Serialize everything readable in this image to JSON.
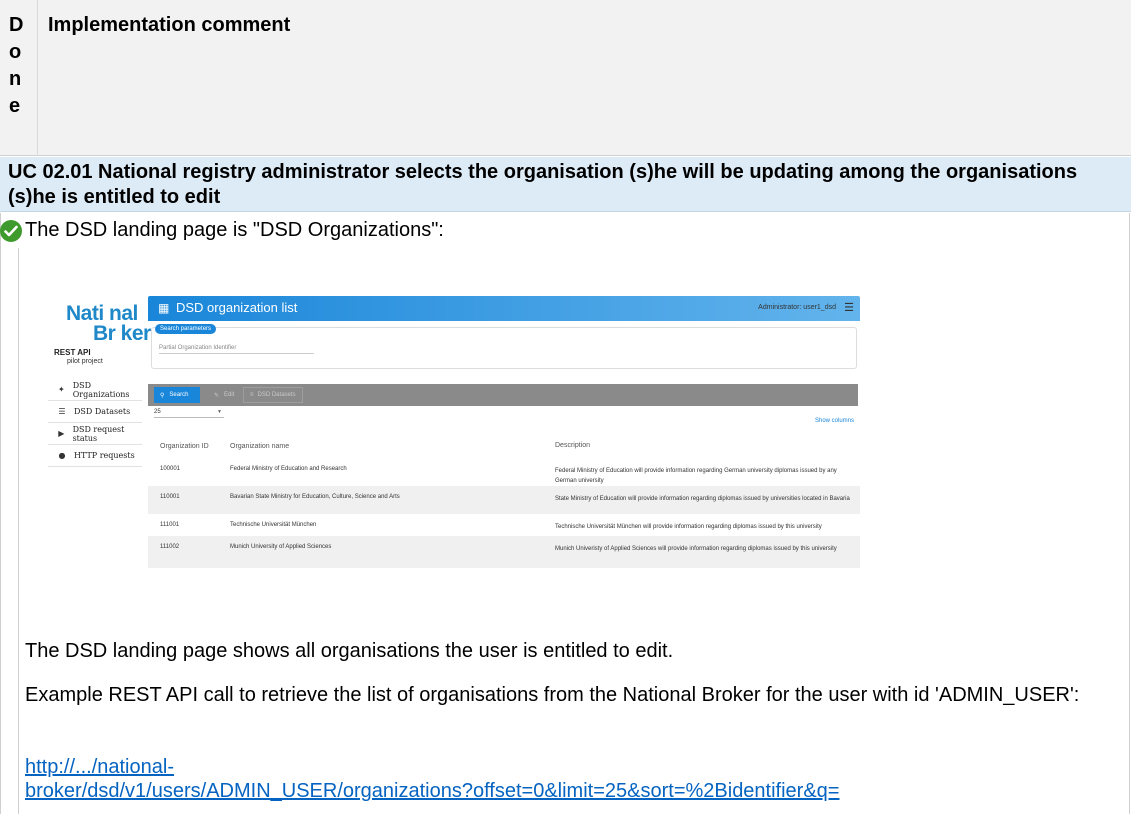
{
  "header": {
    "done_letters": [
      "D",
      "o",
      "n",
      "e"
    ],
    "implementation_comment": "Implementation comment"
  },
  "use_case": {
    "title": "UC 02.01 National registry administrator selects the organisation (s)he will be updating among the organisations (s)he is entitled to edit"
  },
  "landing": {
    "status_icon": "check-circle-icon",
    "text": "The DSD landing page is \"DSD Organizations\":"
  },
  "screenshot": {
    "logo": {
      "line1": "Nati nal",
      "line2": "Br ker"
    },
    "rest_api": "REST API",
    "pilot": "pilot project",
    "sidebar": [
      {
        "icon": "✦",
        "label": "DSD Organizations"
      },
      {
        "icon": "☰",
        "label": "DSD Datasets"
      },
      {
        "icon": "▶",
        "label": "DSD request status"
      },
      {
        "icon": "●",
        "label": "HTTP requests"
      }
    ],
    "title": "DSD organization list",
    "admin_label": "Administrator: user1_dsd",
    "search_params_badge": "Search parameters",
    "partial_id_placeholder": "Partial Organization Identifier",
    "buttons": {
      "search": "Search",
      "edit": "Edit",
      "datasets": "DSD Datasets"
    },
    "page_size": "25",
    "show_columns": "Show columns",
    "columns": [
      "Organization ID",
      "Organization name",
      "Description"
    ],
    "rows": [
      {
        "id": "100001",
        "name": "Federal Ministry of Education and Research",
        "description": "Federal Ministry of Education will provide information regarding German university diplomas issued by any German university"
      },
      {
        "id": "110001",
        "name": "Bavarian State Ministry for Education, Culture, Science and Arts",
        "description": "State Ministry of Education will provide information regarding diplomas issued by universities located in Bavaria"
      },
      {
        "id": "111001",
        "name": "Technische Universität München",
        "description": "Technische Universität München will provide information regarding diplomas issued by this university"
      },
      {
        "id": "111002",
        "name": "Munich University of Applied Sciences",
        "description": "Munich Univeristy of Applied Sciences will provide information regarding diplomas issued by this university"
      }
    ]
  },
  "body": {
    "p1": "The DSD landing page shows all organisations the user is entitled to edit.",
    "p2": "Example REST API call to retrieve the list of organisations from the National Broker for the user with id 'ADMIN_USER':",
    "link_line1": "http://.../national-",
    "link_line2": "broker/dsd/v1/users/ADMIN_USER/organizations?offset=0&limit=25&sort=%2Bidentifier&q="
  }
}
